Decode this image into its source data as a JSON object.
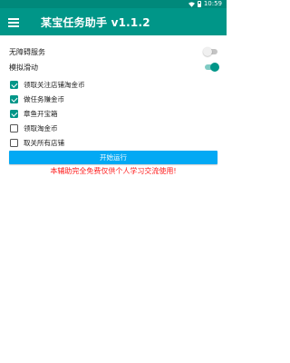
{
  "status_bar": {
    "time": "10:59",
    "wifi_icon": "wifi-icon",
    "battery_icon": "battery-icon",
    "color": "#00897b"
  },
  "app_bar": {
    "title": "某宝任务助手 v1.1.2",
    "menu_icon": "menu-icon",
    "color": "#009688"
  },
  "switches": [
    {
      "label": "无障碍服务",
      "on": false
    },
    {
      "label": "模拟滑动",
      "on": true
    }
  ],
  "tasks": [
    {
      "label": "领取关注店铺淘金币",
      "checked": true
    },
    {
      "label": "做任务赚金币",
      "checked": true
    },
    {
      "label": "章鱼开宝箱",
      "checked": true
    },
    {
      "label": "领取淘金币",
      "checked": false
    },
    {
      "label": "取关所有店铺",
      "checked": false
    }
  ],
  "start_button": {
    "label": "开始运行",
    "color": "#03a9f4"
  },
  "disclaimer": {
    "text": "本辅助完全免费仅供个人学习交流使用!",
    "color": "#ff1a1a"
  }
}
